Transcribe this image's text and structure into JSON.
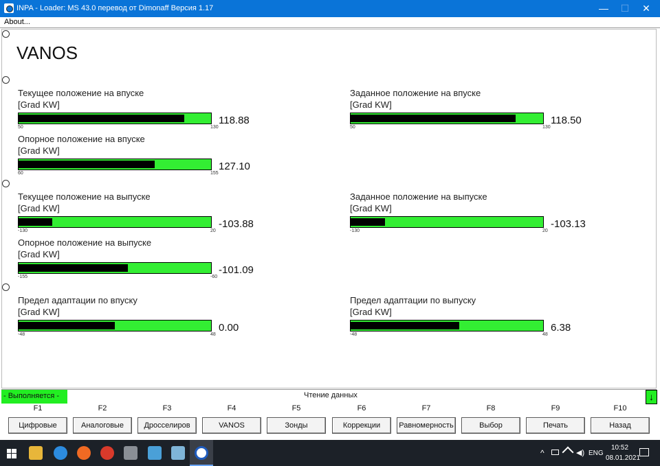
{
  "window": {
    "title": "INPA - Loader:  MS 43.0 перевод от Dimonaff Версия 1.17",
    "min_glyph": "—",
    "max_glyph": "☐",
    "close_glyph": "✕"
  },
  "menu": {
    "about": "About..."
  },
  "page": {
    "title": "VANOS"
  },
  "gauges": [
    {
      "label": "Текущее положение на впуске",
      "unit": "[Grad KW]",
      "min": "50",
      "max": "130",
      "value": "118.88",
      "fraction": 0.86
    },
    {
      "label": "Заданное положение на впуске",
      "unit": "[Grad KW]",
      "min": "50",
      "max": "130",
      "value": "118.50",
      "fraction": 0.856
    },
    {
      "label": "Опорное положение на впуске",
      "unit": "[Grad KW]",
      "min": "60",
      "max": "155",
      "value": "127.10",
      "fraction": 0.706
    },
    {
      "label": "Текущее положение на выпуске",
      "unit": "[Grad KW]",
      "min": "-130",
      "max": "20",
      "value": "-103.88",
      "fraction": 0.175
    },
    {
      "label": "Заданное положение на выпуске",
      "unit": "[Grad KW]",
      "min": "-130",
      "max": "20",
      "value": "-103.13",
      "fraction": 0.179
    },
    {
      "label": "Опорное положение на выпуске",
      "unit": "[Grad KW]",
      "min": "-155",
      "max": "-60",
      "value": "-101.09",
      "fraction": 0.567
    },
    {
      "label": "Предел адаптации по впуску",
      "unit": "[Grad KW]",
      "min": "-48",
      "max": "48",
      "value": "0.00",
      "fraction": 0.5
    },
    {
      "label": "Предел адаптации по выпуску",
      "unit": "[Grad KW]",
      "min": "-48",
      "max": "48",
      "value": "6.38",
      "fraction": 0.566
    }
  ],
  "status": {
    "running": "- Выполняется -",
    "reading": "Чтение данных",
    "arrow": "↓",
    "color": "#22ee22"
  },
  "fkeys": [
    {
      "key": "F1",
      "label": "Цифровые"
    },
    {
      "key": "F2",
      "label": "Аналоговые"
    },
    {
      "key": "F3",
      "label": "Дросселиров"
    },
    {
      "key": "F4",
      "label": "VANOS"
    },
    {
      "key": "F5",
      "label": "Зонды"
    },
    {
      "key": "F6",
      "label": "Коррекции"
    },
    {
      "key": "F7",
      "label": "Равномерность"
    },
    {
      "key": "F8",
      "label": "Выбор"
    },
    {
      "key": "F9",
      "label": "Печать"
    },
    {
      "key": "F10",
      "label": "Назад"
    }
  ],
  "taskbar": {
    "icons": [
      "windows-start-icon",
      "file-explorer-icon",
      "internet-explorer-icon",
      "firefox-icon",
      "ccleaner-icon",
      "app-icon",
      "app-window-icon",
      "notepad-icon",
      "inpa-bmw-icon"
    ],
    "lang": "ENG",
    "time": "10:52",
    "date": "08.01.2021",
    "tray_chevron": "^"
  },
  "colors": {
    "titlebar": "#0a74d8",
    "bar_green": "#33ee33",
    "taskbar": "#1c2128"
  }
}
